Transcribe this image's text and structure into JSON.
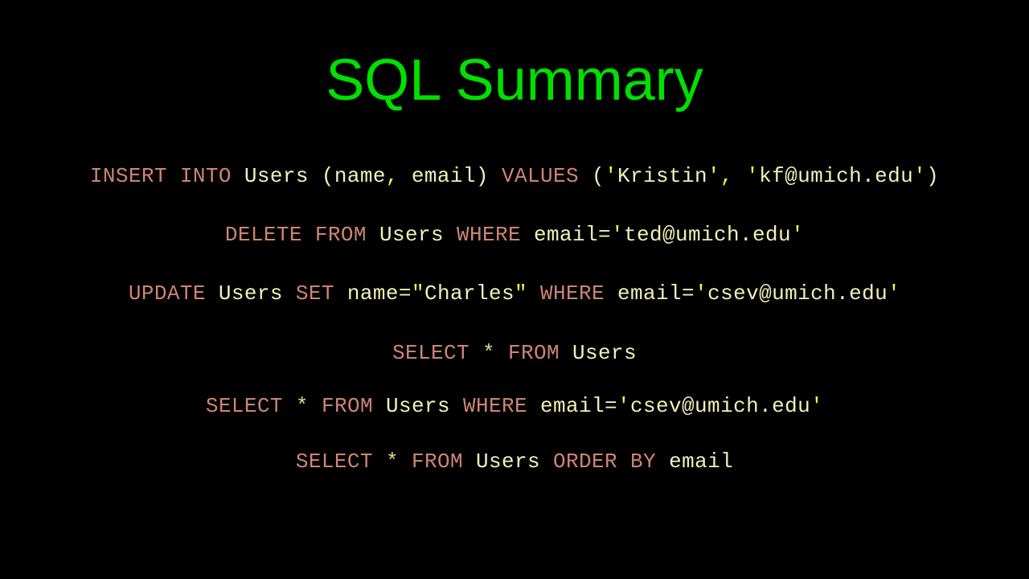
{
  "slide": {
    "title": "SQL Summary",
    "background_color": "#000000",
    "title_color": "#00e000",
    "keyword_color": "#cd8573",
    "identifier_color": "#f2f0b8",
    "punctuation_color": "#f4f44a",
    "star_color": "#dedc7a"
  },
  "code_lines": [
    {
      "id": "insert-statement",
      "text": "INSERT INTO Users (name, email) VALUES ('Kristin', 'kf@umich.edu')",
      "tokens": [
        {
          "t": "INSERT",
          "k": "kw"
        },
        {
          "t": " ",
          "k": "id"
        },
        {
          "t": "INTO",
          "k": "kw"
        },
        {
          "t": " Users (name",
          "k": "id"
        },
        {
          "t": ",",
          "k": "punct"
        },
        {
          "t": " email) ",
          "k": "id"
        },
        {
          "t": "VALUES",
          "k": "kw"
        },
        {
          "t": " (",
          "k": "id"
        },
        {
          "t": "'",
          "k": "punct"
        },
        {
          "t": "Kristin",
          "k": "id"
        },
        {
          "t": "'",
          "k": "punct"
        },
        {
          "t": ",",
          "k": "punct"
        },
        {
          "t": " ",
          "k": "id"
        },
        {
          "t": "'",
          "k": "punct"
        },
        {
          "t": "kf@umich.edu",
          "k": "id"
        },
        {
          "t": "'",
          "k": "punct"
        },
        {
          "t": ")",
          "k": "id"
        }
      ]
    },
    {
      "id": "delete-statement",
      "text": "DELETE FROM Users WHERE email='ted@umich.edu'",
      "tokens": [
        {
          "t": "DELETE",
          "k": "kw"
        },
        {
          "t": " ",
          "k": "id"
        },
        {
          "t": "FROM",
          "k": "kw"
        },
        {
          "t": " Users ",
          "k": "id"
        },
        {
          "t": "WHERE",
          "k": "kw"
        },
        {
          "t": " email=",
          "k": "id"
        },
        {
          "t": "'",
          "k": "punct"
        },
        {
          "t": "ted@umich.edu",
          "k": "id"
        },
        {
          "t": "'",
          "k": "punct"
        }
      ]
    },
    {
      "id": "update-statement",
      "text": "UPDATE Users SET name=\"Charles\" WHERE email='csev@umich.edu'",
      "tokens": [
        {
          "t": "UPDATE",
          "k": "kw"
        },
        {
          "t": " Users ",
          "k": "id"
        },
        {
          "t": "SET",
          "k": "kw"
        },
        {
          "t": " name=",
          "k": "id"
        },
        {
          "t": "\"",
          "k": "punct"
        },
        {
          "t": "Charles",
          "k": "id"
        },
        {
          "t": "\"",
          "k": "punct"
        },
        {
          "t": " ",
          "k": "id"
        },
        {
          "t": "WHERE",
          "k": "kw"
        },
        {
          "t": " email=",
          "k": "id"
        },
        {
          "t": "'",
          "k": "punct"
        },
        {
          "t": "csev@umich.edu",
          "k": "id"
        },
        {
          "t": "'",
          "k": "punct"
        }
      ]
    },
    {
      "id": "select-all-statement",
      "text": "SELECT * FROM Users",
      "tokens": [
        {
          "t": "SELECT",
          "k": "kw"
        },
        {
          "t": " ",
          "k": "id"
        },
        {
          "t": "*",
          "k": "star"
        },
        {
          "t": " ",
          "k": "id"
        },
        {
          "t": "FROM",
          "k": "kw"
        },
        {
          "t": " Users",
          "k": "id"
        }
      ]
    },
    {
      "id": "select-where-statement",
      "text": "SELECT * FROM Users WHERE email='csev@umich.edu'",
      "tokens": [
        {
          "t": "SELECT",
          "k": "kw"
        },
        {
          "t": " ",
          "k": "id"
        },
        {
          "t": "*",
          "k": "star"
        },
        {
          "t": " ",
          "k": "id"
        },
        {
          "t": "FROM",
          "k": "kw"
        },
        {
          "t": " Users ",
          "k": "id"
        },
        {
          "t": "WHERE",
          "k": "kw"
        },
        {
          "t": " email=",
          "k": "id"
        },
        {
          "t": "'",
          "k": "punct"
        },
        {
          "t": "csev@umich.edu",
          "k": "id"
        },
        {
          "t": "'",
          "k": "punct"
        }
      ]
    },
    {
      "id": "select-order-statement",
      "text": "SELECT * FROM Users ORDER BY email",
      "tokens": [
        {
          "t": "SELECT",
          "k": "kw"
        },
        {
          "t": " ",
          "k": "id"
        },
        {
          "t": "*",
          "k": "star"
        },
        {
          "t": " ",
          "k": "id"
        },
        {
          "t": "FROM",
          "k": "kw"
        },
        {
          "t": " Users ",
          "k": "id"
        },
        {
          "t": "ORDER",
          "k": "kw"
        },
        {
          "t": " ",
          "k": "id"
        },
        {
          "t": "BY",
          "k": "kw"
        },
        {
          "t": " email",
          "k": "id"
        }
      ]
    }
  ]
}
